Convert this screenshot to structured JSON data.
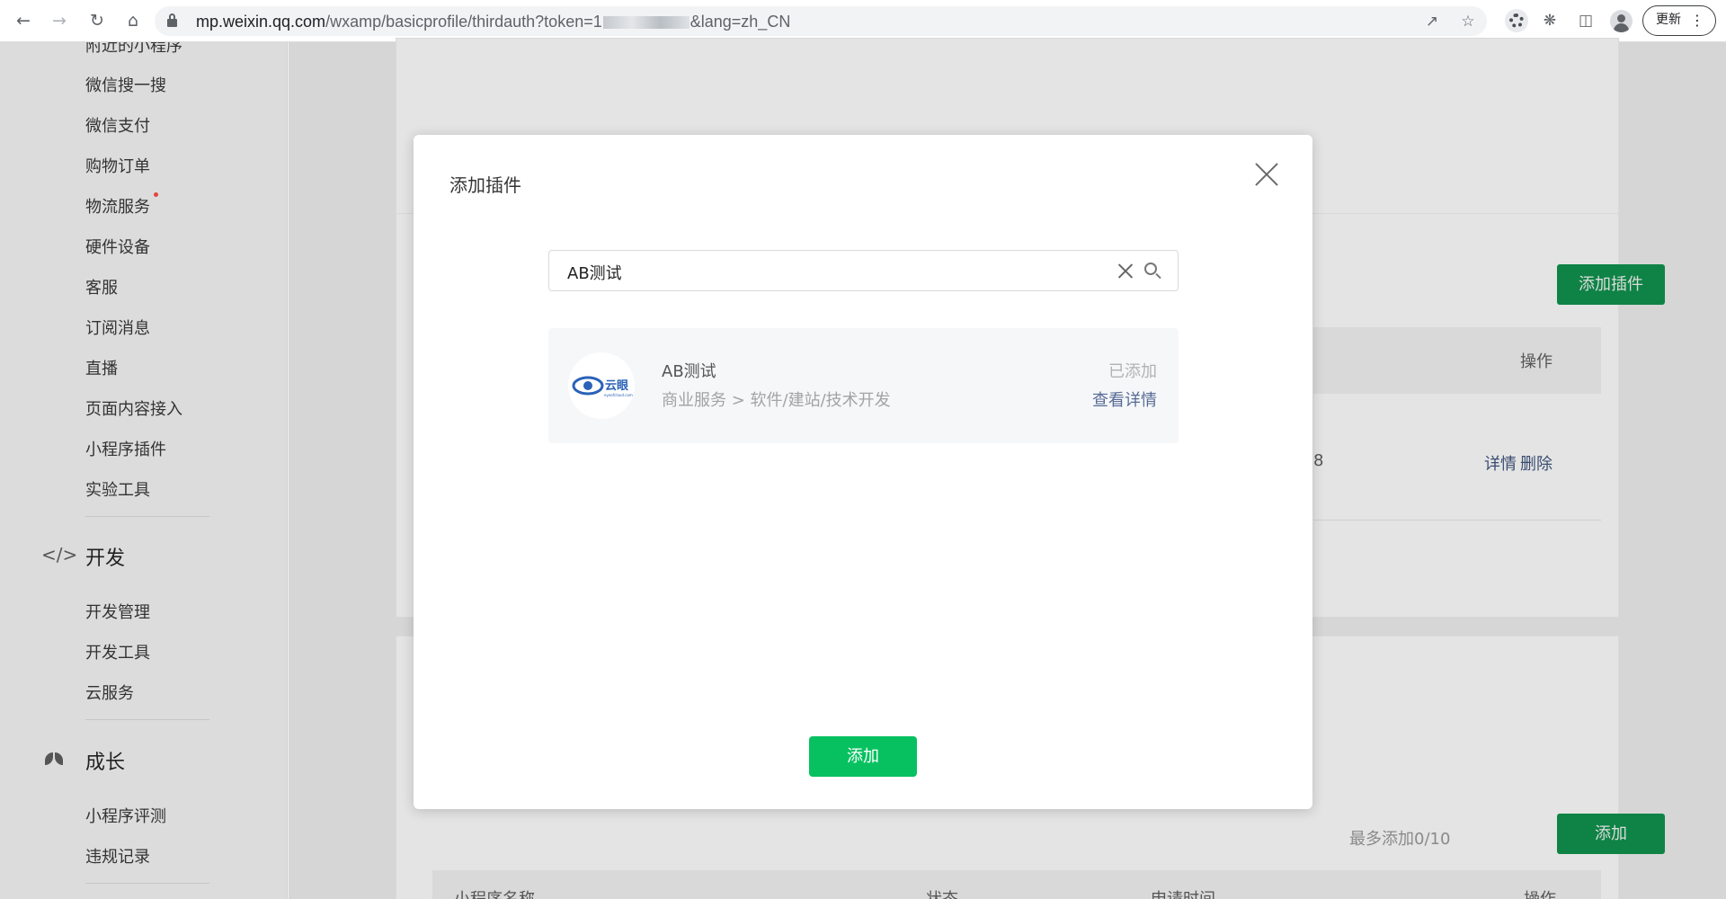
{
  "browser": {
    "url_host": "mp.weixin.qq.com",
    "url_path_before": "/wxamp/basicprofile/thirdauth?token=1",
    "url_path_after": "&lang=zh_CN",
    "update_label": "更新"
  },
  "sidebar": {
    "top_partial": "附近的小程序",
    "items_a": [
      "微信搜一搜",
      "微信支付",
      "购物订单",
      "物流服务",
      "硬件设备",
      "客服",
      "订阅消息",
      "直播",
      "页面内容接入",
      "小程序插件",
      "实验工具"
    ],
    "section_dev": {
      "label": "开发",
      "icon": "code-icon"
    },
    "items_dev": [
      "开发管理",
      "开发工具",
      "云服务"
    ],
    "section_growth": {
      "label": "成长",
      "icon": "sprout-icon"
    },
    "items_growth": [
      "小程序评测",
      "违规记录"
    ]
  },
  "background": {
    "add_plugin_button": "添加插件",
    "col_operation": "操作",
    "row_fragment": "8",
    "row_detail": "详情",
    "row_delete": "删除",
    "quota_text": "最多添加0/10",
    "add_button": "添加",
    "table2_headers": [
      "小程序名称",
      "状态",
      "申请时间",
      "操作"
    ]
  },
  "modal": {
    "title": "添加插件",
    "search_value": "AB测试",
    "result": {
      "name": "AB测试",
      "category": "商业服务 > 软件/建站/技术开发",
      "status": "已添加",
      "detail_link": "查看详情",
      "logo_text": "云眼",
      "logo_subtext": "eyeofcloud.com"
    },
    "add_label": "添加"
  },
  "colors": {
    "brand_green": "#07c160",
    "link_blue": "#576b95"
  }
}
